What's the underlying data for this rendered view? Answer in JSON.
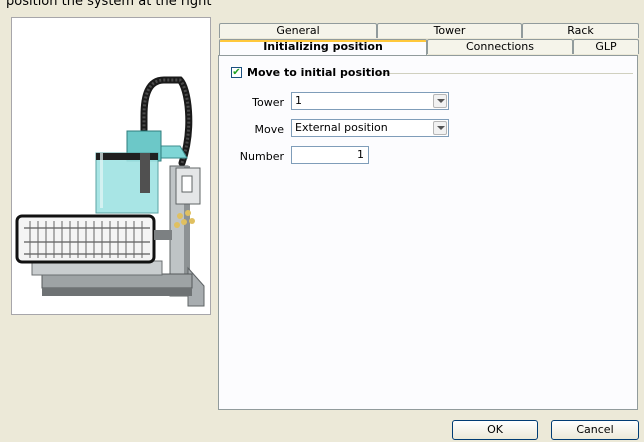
{
  "window": {
    "partial_title": "position the system at the right"
  },
  "tabs_back": [
    "General",
    "Tower",
    "Rack"
  ],
  "tabs_front": [
    "Initializing position",
    "Connections",
    "GLP"
  ],
  "active_tab": "Initializing position",
  "form": {
    "checkbox_label": "Move to initial position",
    "checkbox_checked": true,
    "tower_label": "Tower",
    "tower_value": "1",
    "move_label": "Move",
    "move_value": "External position",
    "number_label": "Number",
    "number_value": "1"
  },
  "buttons": {
    "ok": "OK",
    "cancel": "Cancel"
  },
  "colors": {
    "background": "#ece9d8",
    "active_tab_highlight": "#ffc83c",
    "instrument_cover": "#7fd6d6"
  },
  "icons": {
    "checkbox": "checkmark-icon",
    "dropdown": "chevron-down-icon"
  }
}
